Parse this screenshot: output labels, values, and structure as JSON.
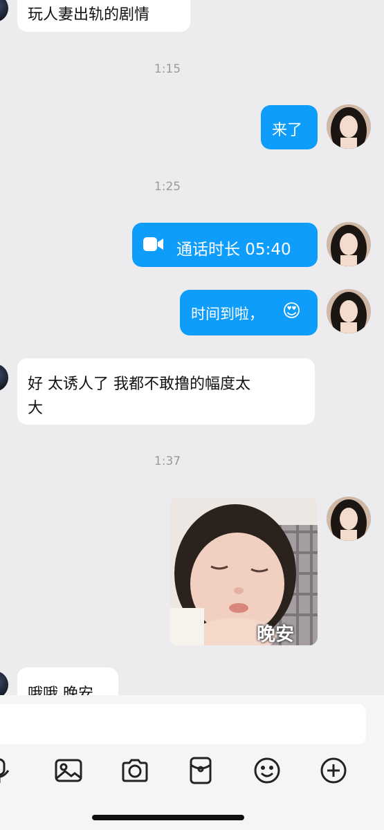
{
  "messages": {
    "m1_text": "玩人妻出轨的剧情",
    "ts1": "1:15",
    "m2_text": "来了",
    "ts2": "1:25",
    "call_text": "通话时长 05:40",
    "m4_text": "时间到啦，",
    "m4_emoji": "😍",
    "m5_line1": "好 太诱人了 我都不敢撸的幅度太",
    "m5_line2": "大",
    "ts3": "1:37",
    "sticker_caption": "晚安",
    "m7_text": "哦哦 晚安"
  },
  "toolbar": {
    "icons": [
      "mic-icon",
      "image-icon",
      "camera-icon",
      "red-packet-icon",
      "emoji-icon",
      "plus-icon"
    ]
  },
  "colors": {
    "outgoing_bubble": "#0f9dfb",
    "incoming_bubble": "#ffffff",
    "background": "#ececee"
  }
}
